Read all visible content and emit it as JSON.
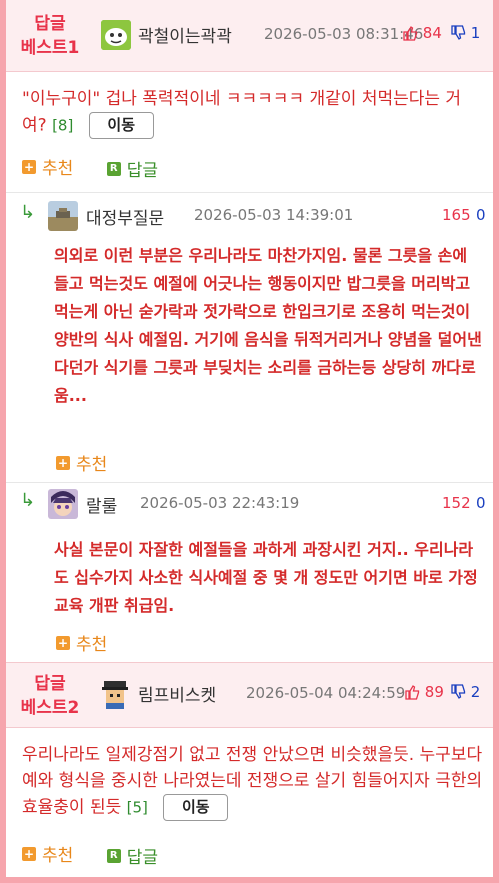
{
  "best1": {
    "badge_line1": "답글",
    "badge_line2": "베스트1",
    "nickname": "곽철이는곽곽",
    "avatar_icon": "cartoon-face-icon",
    "date": "2026-05-03 08:31:46",
    "up": "84",
    "down": "1",
    "body": "\"이누구이\" 겁나 폭력적이네 ㅋㅋㅋㅋㅋ 개같이 처먹는다는 거여?",
    "reply_count": "[8]",
    "move_label": "이동",
    "recommend_label": "추천",
    "reply_label": "답글"
  },
  "reply1": {
    "arrow": "↳",
    "nickname": "대정부질문",
    "avatar_icon": "landscape-photo-icon",
    "date": "2026-05-03 14:39:01",
    "up": "165",
    "down": "0",
    "body": "의외로 이런 부분은 우리나라도 마찬가지임. 물론 그릇을 손에 들고 먹는것도 예절에 어긋나는 행동이지만 밥그릇을 머리박고 먹는게 아닌 숟가락과 젓가락으로 한입크기로 조용히 먹는것이 양반의 식사 예절임. 거기에 음식을 뒤적거리거나 양념을 덜어낸다던가 식기를 그릇과 부딪치는 소리를 금하는등 상당히 까다로움...",
    "recommend_label": "추천"
  },
  "reply2": {
    "arrow": "↳",
    "nickname": "랄룰",
    "avatar_icon": "anime-character-icon",
    "date": "2026-05-03 22:43:19",
    "up": "152",
    "down": "0",
    "body": "사실 본문이 자잘한 예절들을 과하게 과장시킨 거지.. 우리나라도 십수가지 사소한 식사예절 중 몇 개 정도만 어기면 바로 가정교육 개판 취급임.",
    "recommend_label": "추천"
  },
  "best2": {
    "badge_line1": "답글",
    "badge_line2": "베스트2",
    "nickname": "림프비스켓",
    "avatar_icon": "pixel-character-icon",
    "date": "2026-05-04 04:24:59",
    "up": "89",
    "down": "2",
    "body": "우리나라도 일제강점기 없고 전쟁 안났으면 비슷했을듯. 누구보다 예와 형식을 중시한 나라였는데 전쟁으로 살기 힘들어지자 극한의 효율충이 된듯",
    "reply_count": "[5]",
    "move_label": "이동",
    "recommend_label": "추천",
    "reply_label": "답글"
  },
  "colors": {
    "accent_red": "#e8334a",
    "body_red": "#d42a2a",
    "down_blue": "#1a3fbf",
    "header_pink": "#fdeef0",
    "border_pink": "#f6a5ad"
  }
}
